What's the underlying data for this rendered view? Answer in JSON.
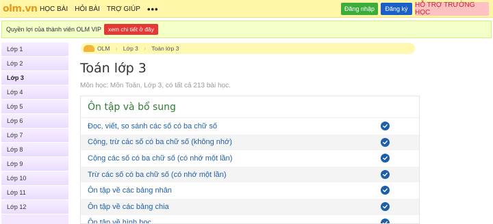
{
  "header": {
    "logo": "olm.vn",
    "nav": [
      "HỌC BÀI",
      "HỎI BÀI",
      "TRỢ GIÚP"
    ],
    "more": "•••",
    "login": "Đăng nhập",
    "register": "Đăng ký",
    "support": "HỖ TRỢ TRƯỜNG HỌC",
    "colors": {
      "bar": "#fff6a8",
      "login": "#3cad3a",
      "register": "#1d5fc8",
      "support": "#ffc1c1"
    }
  },
  "vip": {
    "text": "Quyền lợi của thành viên OLM VIP",
    "button": "xem chi tiết ở đây"
  },
  "sidebar": {
    "items": [
      "Lớp 1",
      "Lớp 2",
      "Lớp 3",
      "Lớp 4",
      "Lớp 5",
      "Lớp 6",
      "Lớp 7",
      "Lớp 8",
      "Lớp 9",
      "Lớp 10",
      "Lớp 11",
      "Lớp 12"
    ],
    "active": "Lớp 3"
  },
  "breadcrumb": [
    "OLM",
    "Lớp 3",
    "Toán lớp 3"
  ],
  "page": {
    "title": "Toán lớp 3",
    "subtitle": "Môn học: Môn Toán, Lớp 3, có tất cả 213 bài học."
  },
  "section": {
    "title": "Ôn tập và bổ sung",
    "lessons": [
      "Đọc, viết, so sánh các số có ba chữ số",
      "Cộng, trừ các số có ba chữ số (không nhớ)",
      "Cộng các số có ba chữ số (có nhớ một lần)",
      "Trừ các số có ba chữ số (có nhớ một lần)",
      "Ôn tập về các bảng nhân",
      "Ôn tập về các bảng chia",
      "Ôn tập về hình học"
    ]
  }
}
